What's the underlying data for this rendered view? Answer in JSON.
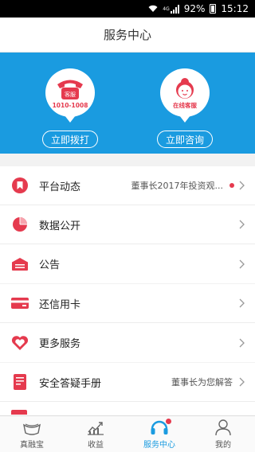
{
  "status_bar": {
    "network": "4G",
    "battery": "92%",
    "time": "15:12"
  },
  "navbar": {
    "title": "服务中心"
  },
  "hero": {
    "phone": {
      "badge": "客服",
      "number": "1010-1008",
      "button": "立即拨打"
    },
    "chat": {
      "badge": "在线客服",
      "button": "立即咨询"
    }
  },
  "sections": [
    [
      {
        "icon": "bookmark-icon",
        "label": "平台动态",
        "sub": "董事长2017年投资观...",
        "dot": true
      },
      {
        "icon": "pie-chart-icon",
        "label": "数据公开",
        "sub": ""
      },
      {
        "icon": "announcement-icon",
        "label": "公告",
        "sub": ""
      }
    ],
    [
      {
        "icon": "credit-card-icon",
        "label": "还信用卡",
        "sub": ""
      },
      {
        "icon": "heart-icon",
        "label": "更多服务",
        "sub": ""
      }
    ],
    [
      {
        "icon": "handbook-icon",
        "label": "安全答疑手册",
        "sub": "董事长为您解答"
      }
    ]
  ],
  "tabs": [
    {
      "icon": "bowl-icon",
      "label": "真融宝"
    },
    {
      "icon": "trend-chart-icon",
      "label": "收益"
    },
    {
      "icon": "headset-icon",
      "label": "服务中心",
      "badge": true
    },
    {
      "icon": "person-icon",
      "label": "我的"
    }
  ],
  "colors": {
    "primary": "#1a9be0",
    "accent": "#e53a4e"
  }
}
